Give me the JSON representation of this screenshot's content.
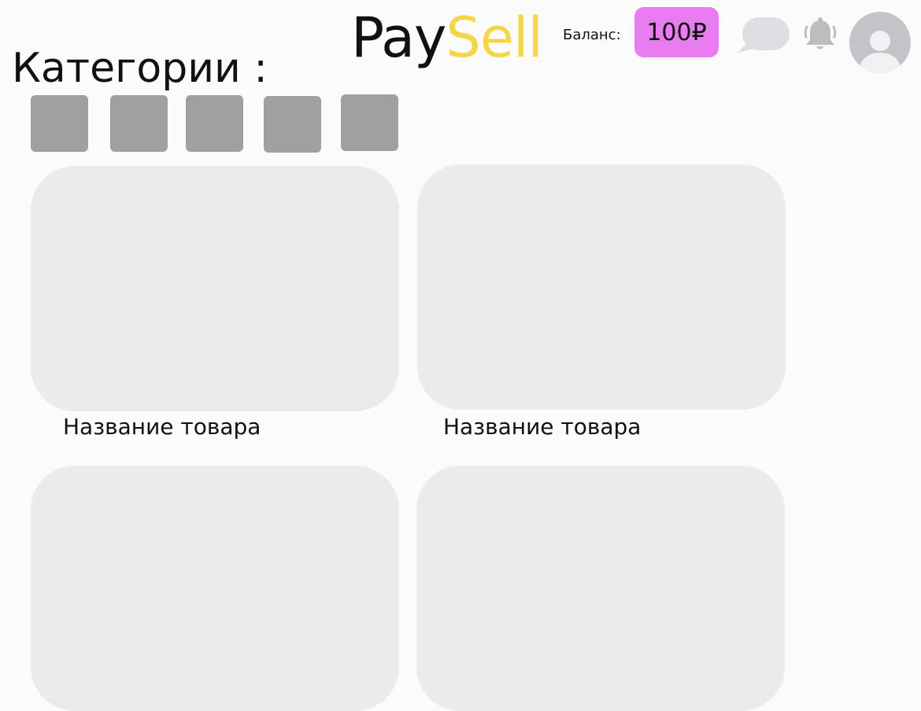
{
  "header": {
    "logo_part1": "Pay",
    "logo_part2": "Sell",
    "balance_label": "Баланс:",
    "balance_value": "100₽",
    "icons": [
      "chat-icon",
      "bell-icon",
      "avatar-icon"
    ]
  },
  "page_title": "Категории :",
  "categories": [
    "",
    "",
    "",
    "",
    ""
  ],
  "products": [
    {
      "name": "Название товара"
    },
    {
      "name": "Название товара"
    },
    {
      "name": ""
    },
    {
      "name": ""
    }
  ],
  "colors": {
    "background": "#fbfbfb",
    "logo_dark": "#111111",
    "logo_accent": "#f5d64a",
    "balance_badge": "#e87cf0",
    "category_chip": "#a0a0a0",
    "product_placeholder": "#ebebeb",
    "icon_gray": "#c4c4c8"
  }
}
